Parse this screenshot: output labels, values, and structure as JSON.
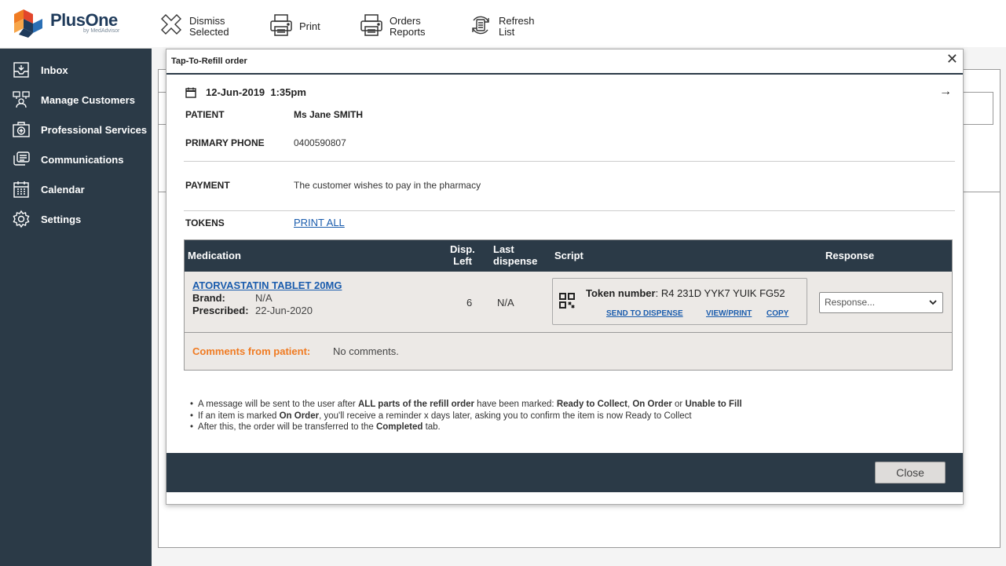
{
  "app": {
    "brand": "PlusOne",
    "brand_sub": "by MedAdvisor"
  },
  "sidebar": {
    "items": [
      {
        "label": "Inbox",
        "icon": "inbox-icon"
      },
      {
        "label": "Manage Customers",
        "icon": "customers-icon"
      },
      {
        "label": "Professional Services",
        "icon": "medical-kit-icon"
      },
      {
        "label": "Communications",
        "icon": "messages-icon"
      },
      {
        "label": "Calendar",
        "icon": "calendar-icon"
      },
      {
        "label": "Settings",
        "icon": "gear-icon"
      }
    ]
  },
  "toolbar": {
    "dismiss_line1": "Dismiss",
    "dismiss_line2": "Selected",
    "print": "Print",
    "orders_line1": "Orders",
    "orders_line2": "Reports",
    "refresh_line1": "Refresh",
    "refresh_line2": "List"
  },
  "modal": {
    "title": "Tap-To-Refill order",
    "close_symbol": "✕",
    "date": "12-Jun-2019  1:35pm",
    "next_symbol": "→",
    "patient_label": "PATIENT",
    "patient_value": "Ms Jane SMITH",
    "phone_label": "PRIMARY PHONE",
    "phone_value": "0400590807",
    "payment_label": "PAYMENT",
    "payment_value": "The customer wishes to pay in the pharmacy",
    "tokens_label": "TOKENS",
    "tokens_link": "PRINT ALL",
    "table": {
      "headers": {
        "medication": "Medication",
        "disp_left_1": "Disp.",
        "disp_left_2": "Left",
        "last_1": "Last",
        "last_2": "dispense",
        "script": "Script",
        "response": "Response"
      },
      "row": {
        "name": "ATORVASTATIN TABLET 20MG",
        "brand_label": "Brand:",
        "brand_value": "N/A",
        "prescribed_label": "Prescribed:",
        "prescribed_value": "22-Jun-2020",
        "disp_left": "6",
        "last_dispense": "N/A",
        "token_label": "Token number",
        "token_value": ": R4 231D YYK7 YUIK FG52",
        "send_to_dispense": "SEND TO DISPENSE",
        "view_print": "VIEW/PRINT",
        "copy": "COPY",
        "response_placeholder": "Response...",
        "response_chevron": "⌄"
      },
      "comments_label": "Comments from patient:",
      "comments_value": "No comments."
    },
    "notes": {
      "n1_a": "A message will be sent to the user after ",
      "n1_b": "ALL parts of the refill order",
      "n1_c": " have been marked: ",
      "n1_d": "Ready to Collect",
      "n1_e": ", ",
      "n1_f": "On Order",
      "n1_g": " or ",
      "n1_h": "Unable to Fill",
      "n2_a": "If an item is marked ",
      "n2_b": "On Order",
      "n2_c": ", you'll receive a reminder x days later, asking you to confirm the item is now Ready to Collect",
      "n3_a": "After this, the order will be transferred to the ",
      "n3_b": "Completed",
      "n3_c": " tab."
    },
    "close_button": "Close"
  },
  "colors": {
    "sidebar_bg": "#2b3a47",
    "link": "#1a5cad",
    "comments_accent": "#f07b22",
    "table_row_bg": "#ece9e6"
  }
}
